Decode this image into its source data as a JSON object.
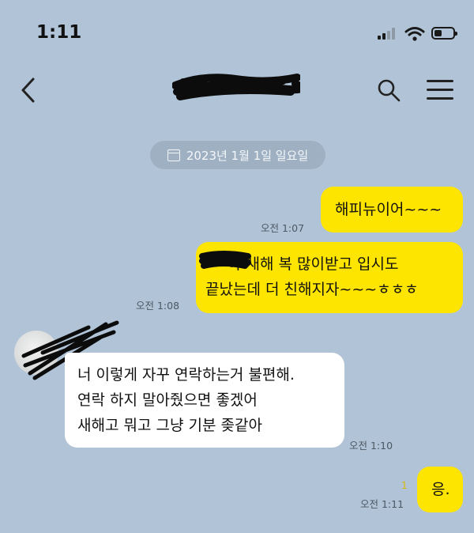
{
  "status_bar": {
    "time": "1:11",
    "signal_icon": "cellular-signal-icon",
    "wifi_icon": "wifi-icon",
    "battery_icon": "battery-icon"
  },
  "header": {
    "back_icon": "chevron-left-icon",
    "search_icon": "search-icon",
    "menu_icon": "hamburger-menu-icon"
  },
  "date_divider": {
    "icon": "calendar-icon",
    "text": "2023년 1월 1일 일요일"
  },
  "messages": [
    {
      "side": "sent",
      "text": "해피뉴이어~~~",
      "time": "오전 1:07"
    },
    {
      "side": "sent",
      "lines": [
        "아 새해 복 많이받고 입시도",
        "끝났는데 더 친해지자~~~ㅎㅎㅎ"
      ],
      "time": "오전 1:08"
    },
    {
      "side": "received",
      "lines": [
        "너 이렇게 자꾸 연락하는거 불편해.",
        "연락 하지 말아줬으면 좋겠어",
        "새해고 뭐고 그냥 기분 좆같아"
      ],
      "time": "오전 1:10"
    },
    {
      "side": "sent",
      "text": "응.",
      "time": "오전 1:11",
      "unread_count": "1"
    }
  ],
  "colors": {
    "background": "#b1c3d6",
    "sent_bubble": "#fee500",
    "received_bubble": "#ffffff",
    "date_pill": "#9eb0c2"
  }
}
